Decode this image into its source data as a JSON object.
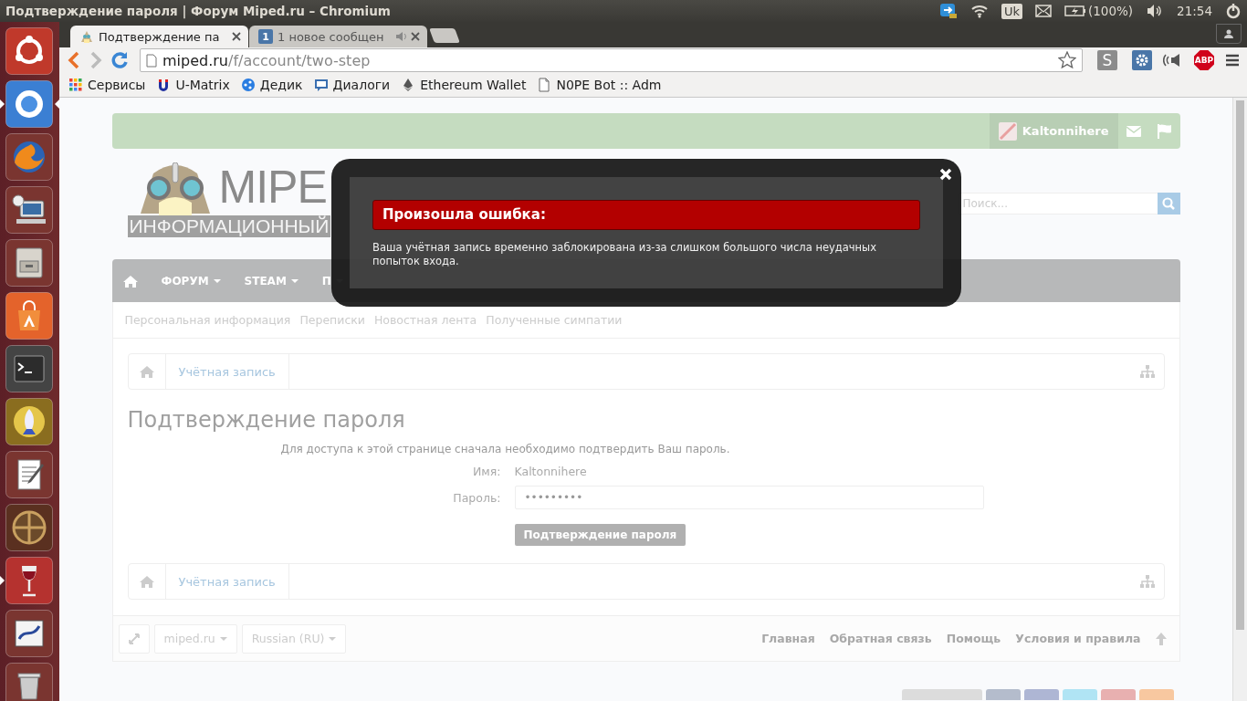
{
  "window": {
    "title": "Подтверждение пароля | Форум Miped.ru – Chromium"
  },
  "top_panel": {
    "keyboard_layout": "Uk",
    "battery": "(100%)",
    "clock": "21:54"
  },
  "launcher": [
    {
      "kind": "logo",
      "running": false,
      "focused": false
    },
    {
      "kind": "ring",
      "running": true,
      "focused": true
    },
    {
      "kind": "globe",
      "running": false,
      "focused": false
    },
    {
      "kind": "computer",
      "running": false,
      "focused": false
    },
    {
      "kind": "cabinet",
      "running": false,
      "focused": false
    },
    {
      "kind": "bag",
      "running": false,
      "focused": false
    },
    {
      "kind": "terminal",
      "running": false,
      "focused": false
    },
    {
      "kind": "rocket",
      "running": false,
      "focused": false
    },
    {
      "kind": "notepad",
      "running": false,
      "focused": false
    },
    {
      "kind": "crosshair",
      "running": false,
      "focused": false
    },
    {
      "kind": "wineglass",
      "running": true,
      "focused": false
    },
    {
      "kind": "image",
      "running": false,
      "focused": false
    },
    {
      "kind": "bin",
      "running": false,
      "focused": false
    }
  ],
  "tabs": [
    {
      "title": "Подтверждение па",
      "selected": true
    },
    {
      "favicon_text": "1",
      "title": "1 новое сообщен",
      "selected": false,
      "audio": true
    }
  ],
  "address_bar": {
    "host": "miped.ru",
    "path": "/f/account/two-step"
  },
  "extensions": [
    {
      "kind": "letter",
      "label": "S"
    },
    {
      "kind": "gear"
    },
    {
      "kind": "speaker"
    },
    {
      "kind": "stop",
      "label": "ABP"
    }
  ],
  "bookmarks": [
    {
      "kind": "apps",
      "label": "Сервисы"
    },
    {
      "kind": "magnet",
      "label": "U-Matrix"
    },
    {
      "kind": "dots",
      "label": "Дедик"
    },
    {
      "kind": "chat",
      "label": "Диалоги"
    },
    {
      "kind": "diamond",
      "label": "Ethereum Wallet"
    },
    {
      "kind": "page",
      "label": "N0PE Bot :: Adm"
    }
  ],
  "page": {
    "user": {
      "name": "Kaltonnihere"
    },
    "search": {
      "placeholder": "Поиск..."
    },
    "logo": {
      "title": "MIPE",
      "subtitle": "ИНФОРМАЦИОННЫЙ"
    },
    "nav": [
      {
        "label": "ФОРУМ"
      },
      {
        "label": "STEAM"
      },
      {
        "label": "П"
      }
    ],
    "subnav": [
      "Персональная информация",
      "Переписки",
      "Новостная лента",
      "Полученные симпатии"
    ],
    "breadcrumbs_top": [
      "Учётная запись"
    ],
    "heading": "Подтверждение пароля",
    "intro": "Для доступа к этой странице сначала необходимо подтвердить Ваш пароль.",
    "fields": [
      {
        "kind": "text",
        "label": "Имя:",
        "value": "Kaltonnihere"
      },
      {
        "kind": "input",
        "label": "Пароль:",
        "value": "•••••••••"
      }
    ],
    "submit": "Подтверждение пароля",
    "breadcrumbs_bottom": [
      "Учётная запись"
    ],
    "footer": {
      "style_chooser": "miped.ru",
      "language_chooser": "Russian (RU)",
      "links": [
        "Главная",
        "Обратная связь",
        "Помощь",
        "Условия и правила"
      ]
    }
  },
  "error_dialog": {
    "title": "Произошла ошибка:",
    "message": "Ваша учётная запись временно заблокирована из-за слишком большого числа неудачных попыток входа."
  }
}
